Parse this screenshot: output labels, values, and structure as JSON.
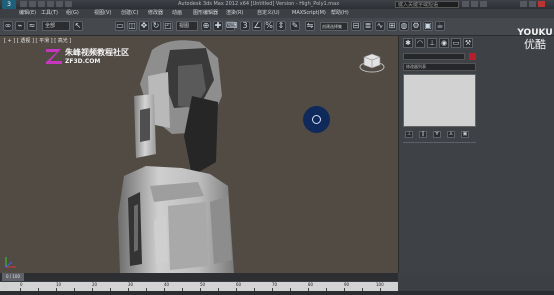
{
  "titlebar": {
    "logo_text": "3",
    "title": "Autodesk 3ds Max 2012 x64  [Untitled] Version  - High_Poly1.max",
    "search_placeholder": "键入关键字或短语"
  },
  "menubar": {
    "items": [
      "编辑(E)",
      "工具(T)",
      "组(G)",
      "视图(V)",
      "创建(C)",
      "修改器",
      "动画",
      "图形编辑器",
      "渲染(R)",
      "自定义(U)",
      "MAXScript(M)",
      "帮助(H)"
    ]
  },
  "toolbar": {
    "filter_value": "全部",
    "view_value": "视图",
    "selection_set_value": "创建选择集"
  },
  "viewport": {
    "label": "[ + ] [ 透视 ] [ 平滑 ] [ 高光 ]",
    "watermark_line1": "朱峰视频教程社区",
    "watermark_line2": "ZF3D.COM",
    "accent_color": "#1f4f95"
  },
  "command_panel": {
    "modifier_list_value": "修改器列表"
  },
  "overlay": {
    "youku_en": "YOUKU",
    "youku_zh": "优酷"
  },
  "timeline": {
    "frame_indicator": "0 / 100",
    "ticks": [
      "0",
      "10",
      "20",
      "30",
      "40",
      "50",
      "60",
      "70",
      "80",
      "90",
      "100"
    ],
    "status_icon": "登"
  }
}
